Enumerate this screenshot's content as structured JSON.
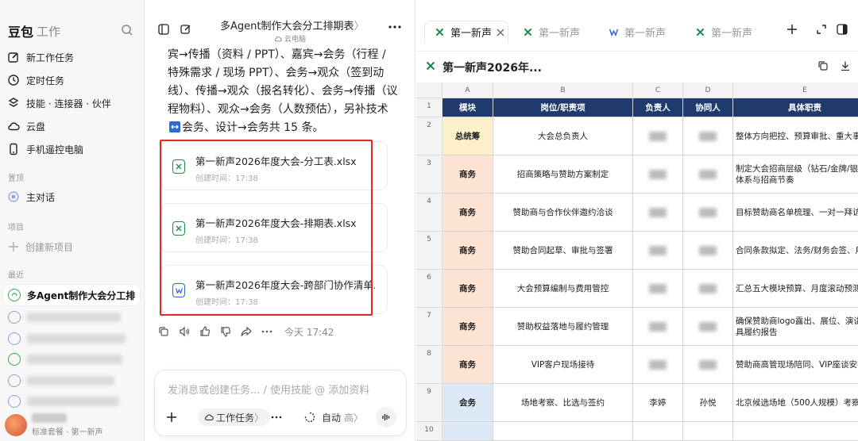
{
  "colors": {
    "accent": "#1f3b6d",
    "highlight_box": "#e02a2a",
    "excel_green": "#1e8c4e",
    "word_blue": "#2b6ad6",
    "mod_total": "#fcefc9",
    "mod_business": "#fde3d3",
    "mod_meeting": "#dde9f6"
  },
  "sidebar": {
    "brand": "豆包",
    "brand_sub": "工作",
    "nav": [
      {
        "icon": "edit-icon",
        "label": "新工作任务"
      },
      {
        "icon": "clock-icon",
        "label": "定时任务"
      },
      {
        "icon": "skills-icon",
        "label": "技能 · 连接器 · 伙伴"
      },
      {
        "icon": "cloud-icon",
        "label": "云盘"
      },
      {
        "icon": "phone-icon",
        "label": "手机遥控电脑"
      }
    ],
    "pinned_label": "置顶",
    "pinned_item": "主对话",
    "project_label": "项目",
    "new_project": "创建新项目",
    "recent_label": "最近",
    "recent_active": "多Agent制作大会分工排期表",
    "user_plan": "标准套餐 · 第一新声"
  },
  "chat": {
    "title": "多Agent制作大会分工排期表",
    "title_suffix": "〉",
    "subtitle": "云电脑",
    "message": "宾→传播（资料 / PPT）、嘉宾→会务（行程 / 特殊需求 / 现场 PPT）、会务→观众（签到动线）、传播→观众（报名转化）、会务→传播（议程物料）、观众→会务（人数预估），另补技术",
    "message_tail": "会务、设计→会务共 15 条。",
    "files": [
      {
        "type": "xlsx",
        "name": "第一新声2026年度大会-分工表.xlsx",
        "time": "创建时间：17:38"
      },
      {
        "type": "xlsx",
        "name": "第一新声2026年度大会-排期表.xlsx",
        "time": "创建时间：17:38"
      },
      {
        "type": "docx",
        "name": "第一新声2026年度大会-跨部门协作清单...",
        "time": "创建时间：17:38"
      }
    ],
    "timestamp": "今天 17:42",
    "input_placeholder": "发消息或创建任务... / 使用技能 @ 添加资料",
    "task_chip": "工作任务",
    "task_chip_suffix": "〉",
    "auto_label": "自动",
    "auto_level": "高",
    "auto_suffix": "〉"
  },
  "tabs": [
    {
      "icon": "excel-icon",
      "label": "第一新声",
      "active": true
    },
    {
      "icon": "excel-icon",
      "label": "第一新声",
      "active": false
    },
    {
      "icon": "word-icon",
      "label": "第一新声",
      "active": false
    },
    {
      "icon": "excel-icon",
      "label": "第一新声",
      "active": false
    }
  ],
  "document": {
    "title": "第一新声2026年..."
  },
  "sheet": {
    "col_letters": [
      "A",
      "B",
      "C",
      "D",
      "E"
    ],
    "row_numbers": [
      "1",
      "2",
      "3",
      "4",
      "5",
      "6",
      "7",
      "8",
      "9",
      "10"
    ],
    "headers": [
      "模块",
      "岗位/职责项",
      "负责人",
      "协同人",
      "具体职责"
    ],
    "rows": [
      {
        "module": "总统筹",
        "role": "大会总负责人",
        "owner": "",
        "helper": "",
        "duty": "整体方向把控、预算审批、重大事"
      },
      {
        "module": "商务",
        "role": "招商策略与赞助方案制定",
        "owner": "",
        "helper": "",
        "duty": "制定大会招商层级（钻石/金牌/银牌体系与招商节奏"
      },
      {
        "module": "商务",
        "role": "赞助商与合作伙伴邀约洽谈",
        "owner": "",
        "helper": "",
        "duty": "目标赞助商名单梳理、一对一拜访"
      },
      {
        "module": "商务",
        "role": "赞助合同起草、审批与签署",
        "owner": "",
        "helper": "",
        "duty": "合同条款拟定、法务/财务会签、用"
      },
      {
        "module": "商务",
        "role": "大会预算编制与费用管控",
        "owner": "",
        "helper": "",
        "duty": "汇总五大模块预算、月度滚动预测"
      },
      {
        "module": "商务",
        "role": "赞助权益落地与履约管理",
        "owner": "",
        "helper": "",
        "duty": "确保赞助商logo露出、展位、演讲出具履约报告"
      },
      {
        "module": "商务",
        "role": "VIP客户现场接待",
        "owner": "",
        "helper": "",
        "duty": "赞助商高管现场陪同、VIP座谈安排"
      },
      {
        "module": "会务",
        "role": "场地考察、比选与签约",
        "owner": "李婷",
        "helper": "孙悦",
        "duty": "北京候选场地（500人规模）考察定"
      }
    ]
  }
}
